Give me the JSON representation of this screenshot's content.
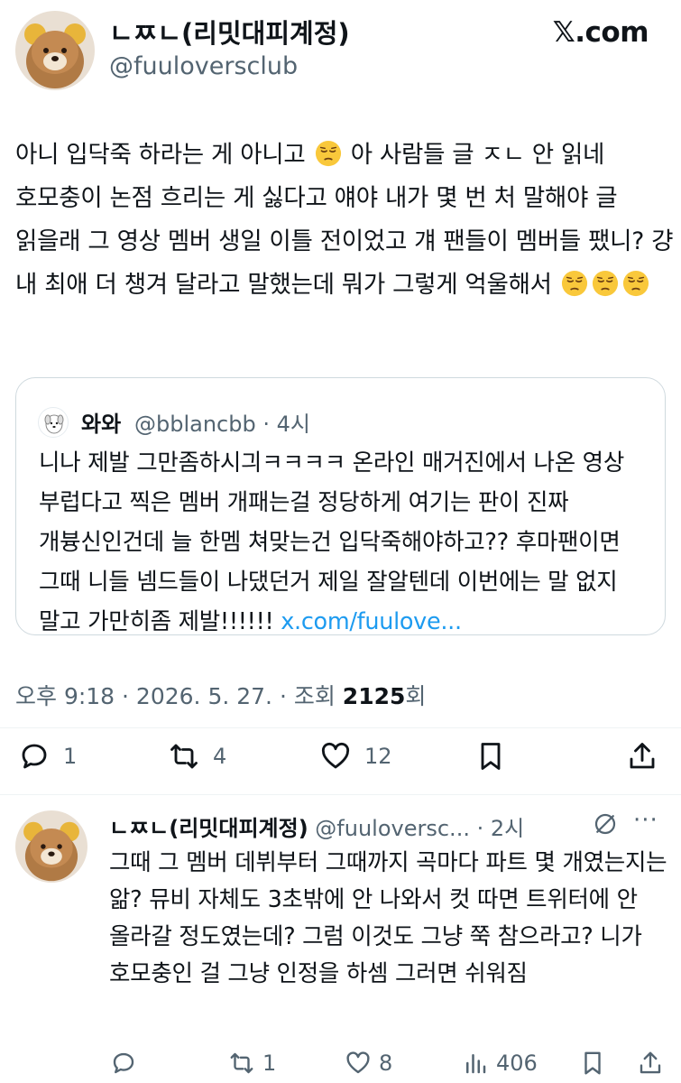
{
  "header": {
    "display_name": "ㄴㅉㄴ(리밋대피계정)",
    "handle": "@fuuloversclub",
    "brand": "𝕏.com"
  },
  "tweet": {
    "text_part1": "아니 입닥죽 하라는 게 아니고",
    "text_part2": "아 사람들 글 ㅈㄴ 안 읽네 호모충이 논점 흐리는 게 싫다고 얘야 내가 몇 번 처 말해야 글 읽을래 그 영상 멤버 생일 이틀 전이었고 걔 팬들이 멤버들 팼니? 걍 내 최애 더 챙겨 달라고 말했는데 뭐가 그렇게 억울해서",
    "emoji_icon": "pensive-face-emoji"
  },
  "quote": {
    "name": "와와",
    "handle": "@bblancbb · 4시",
    "text": "니나 제발 그만좀하시긔ㅋㅋㅋㅋ 온라인 매거진에서 나온 영상 부럽다고 찍은 멤버 개패는걸 정당하게 여기는 판이 진짜 개븅신인건데 늘 한멤 쳐맞는건 입닥죽해야하고?? 후마팬이면 그때 니들 넴드들이 나댔던거 제일 잘알텐데 이번에는 말 없지 말고 가만히좀 제발!!!!!! ",
    "link": "x.com/fuulove..."
  },
  "meta": {
    "time_date": "오후 9:18 · 2026. 5. 27. · 조회 ",
    "views": "2125",
    "views_suffix": "회"
  },
  "actions": {
    "replies": "1",
    "reposts": "4",
    "likes": "12"
  },
  "reply": {
    "name": "ㄴㅉㄴ(리밋대피계정)",
    "handle": " @fuuloversc... · 2시",
    "text": "그때 그 멤버 데뷔부터 그때까지 곡마다 파트 몇 개였는지는 앎? 뮤비 자체도 3초밖에 안 나와서 컷 따면 트위터에 안 올라갈 정도였는데? 그럼 이것도 그냥 쭉 참으라고? 니가 호모충인 걸 그냥 인정을 하셈 그러면 쉬워짐",
    "more": "···",
    "reposts": "1",
    "likes": "8",
    "views": "406"
  },
  "colors": {
    "text": "#0f1419",
    "secondary": "#536471",
    "link": "#1d9bf0",
    "border": "#cfd9de"
  }
}
